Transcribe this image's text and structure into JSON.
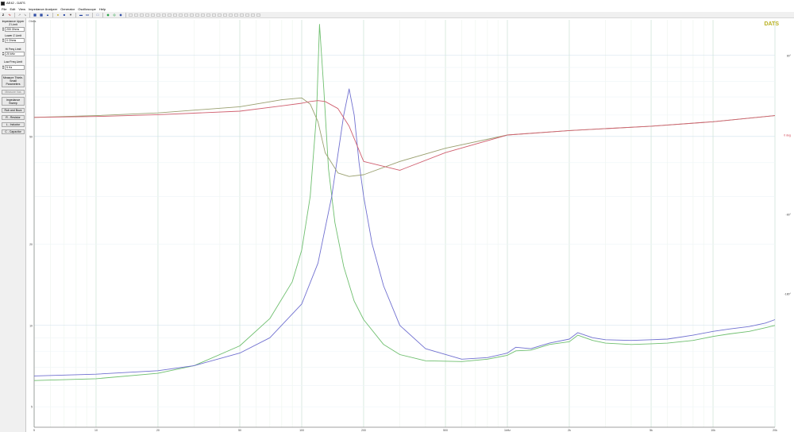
{
  "window": {
    "title": "AE42 - DATS"
  },
  "menu": [
    "File",
    "Edit",
    "View",
    "Impedance Analyzer",
    "Generator",
    "Oscilloscope",
    "Help"
  ],
  "toolbar": {
    "z_label": "Z"
  },
  "sidebar": {
    "impedance_upper_label": "Impedance Upper Z Limit",
    "impedance_upper_value": "200 Ohms",
    "lower_z_label": "Lower Z Limit",
    "lower_z_value": "0 Ohms",
    "hi_freq_label": "Hi Freq Limit",
    "hi_freq_value": "20 kHz",
    "low_freq_label": "Low Freq Limit",
    "low_freq_value": "5 Hz",
    "measure_ts_label": "Measure Thiele-Small Parameters",
    "measure_vas_label": "Measure Vas",
    "impedance_sweep_label": "Impedance Sweep",
    "rub_buzz_label": "Rub and Buzz",
    "resistor_label": "R - Resistor",
    "inductor_label": "L - Inductor",
    "capacitor_label": "C - Capacitor"
  },
  "plot": {
    "brand": "DATS",
    "y_left_unit_top": "Ohms",
    "y_left_ticks": [
      {
        "label": "50",
        "value": 50
      },
      {
        "label": "20",
        "value": 20
      },
      {
        "label": "10",
        "value": 10
      },
      {
        "label": "5",
        "value": 5
      }
    ],
    "y_right_ticks": [
      {
        "label": "90°",
        "value": 90
      },
      {
        "label": "0 deg",
        "value": 0
      },
      {
        "label": "-90°",
        "value": -90
      },
      {
        "label": "-180°",
        "value": -180
      }
    ],
    "x_ticks": [
      {
        "label": "5",
        "value": 5
      },
      {
        "label": "10",
        "value": 10
      },
      {
        "label": "20",
        "value": 20
      },
      {
        "label": "50",
        "value": 50
      },
      {
        "label": "100",
        "value": 100
      },
      {
        "label": "200",
        "value": 200
      },
      {
        "label": "500",
        "value": 500
      },
      {
        "label": "1kHz",
        "value": 1000
      },
      {
        "label": "2k",
        "value": 2000
      },
      {
        "label": "5k",
        "value": 5000
      },
      {
        "label": "10k",
        "value": 10000
      },
      {
        "label": "20k",
        "value": 20000
      }
    ]
  },
  "chart_data": {
    "type": "line",
    "xlabel": "",
    "ylabel": "Ohms",
    "x_scale": "log",
    "y_scale": "log",
    "xlim": [
      5,
      20000
    ],
    "ylim": [
      4.2,
      135
    ],
    "grid": true,
    "series": [
      {
        "color": "#6fbf6f",
        "axis": "left",
        "x": [
          5,
          10,
          20,
          30,
          50,
          70,
          90,
          100,
          110,
          118,
          122,
          128,
          135,
          145,
          160,
          180,
          200,
          250,
          300,
          400,
          600,
          800,
          1000,
          1100,
          1300,
          1600,
          2000,
          2200,
          2600,
          3000,
          4000,
          5000,
          6000,
          8000,
          10000,
          12000,
          15000,
          18000,
          20000
        ],
        "y": [
          6.25,
          6.35,
          6.65,
          7.1,
          8.4,
          10.6,
          14.5,
          19,
          30,
          60,
          130,
          75,
          38,
          24,
          16.5,
          12.3,
          10.5,
          8.5,
          7.8,
          7.4,
          7.35,
          7.5,
          7.75,
          8.05,
          8.1,
          8.5,
          8.7,
          9.2,
          8.8,
          8.6,
          8.5,
          8.55,
          8.6,
          8.8,
          9.1,
          9.3,
          9.5,
          9.8,
          10.0
        ]
      },
      {
        "color": "#7070d0",
        "axis": "left",
        "x": [
          5,
          10,
          20,
          30,
          50,
          70,
          100,
          120,
          140,
          160,
          170,
          180,
          190,
          200,
          220,
          250,
          300,
          400,
          600,
          800,
          1000,
          1100,
          1300,
          1600,
          2000,
          2200,
          2600,
          3000,
          4000,
          5000,
          6000,
          8000,
          10000,
          12000,
          15000,
          18000,
          20000
        ],
        "y": [
          6.5,
          6.6,
          6.8,
          7.1,
          7.9,
          9,
          12,
          17,
          30,
          60,
          75,
          60,
          40,
          30,
          20,
          14,
          10,
          8.2,
          7.5,
          7.6,
          7.9,
          8.3,
          8.2,
          8.6,
          8.9,
          9.4,
          9.0,
          8.85,
          8.8,
          8.85,
          8.9,
          9.2,
          9.5,
          9.7,
          9.9,
          10.2,
          10.5
        ]
      },
      {
        "color": "#9aa070",
        "axis": "right",
        "x": [
          5,
          10,
          20,
          50,
          80,
          100,
          110,
          120,
          130,
          150,
          170,
          200,
          300,
          500,
          1000,
          2000,
          5000,
          10000,
          20000
        ],
        "y": [
          20,
          22,
          25,
          32,
          40,
          42,
          35,
          15,
          -20,
          -43,
          -47,
          -45,
          -30,
          -15,
          0,
          5,
          10,
          15,
          22
        ]
      },
      {
        "color": "#d06070",
        "axis": "right",
        "x": [
          5,
          10,
          20,
          50,
          80,
          100,
          110,
          120,
          130,
          150,
          170,
          200,
          300,
          500,
          1000,
          2000,
          5000,
          10000,
          20000
        ],
        "y": [
          20,
          21,
          23,
          27,
          33,
          36,
          38,
          39,
          38,
          30,
          10,
          -30,
          -40,
          -20,
          0,
          5,
          10,
          15,
          22
        ]
      }
    ]
  }
}
